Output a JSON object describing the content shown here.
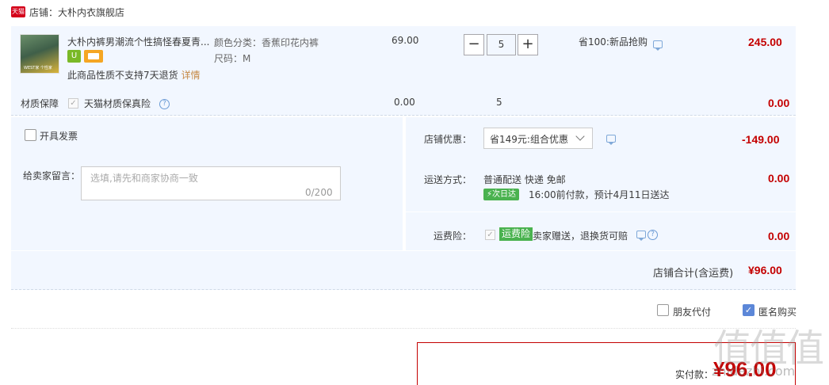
{
  "shop": {
    "logo_text": "天猫",
    "name": "店铺：大朴内衣旗舰店"
  },
  "item": {
    "thumb_caption": "WEST家 个性家",
    "title": "大朴内裤男潮流个性搞怪春夏青...",
    "badge_icon": "U",
    "notice": "此商品性质不支持7天退货",
    "notice_link": "详情",
    "sku_color": "颜色分类：香蕉印花内裤",
    "sku_size": "尺码：M",
    "unit_price": "69.00",
    "qty_minus": "−",
    "qty_value": "5",
    "qty_plus": "+",
    "promo": "省100:新品抢购",
    "subtotal": "245.00"
  },
  "insurance": {
    "label": "材质保障",
    "check_mark": "✓",
    "name": "天猫材质保真险",
    "help": "?",
    "price": "0.00",
    "qty": "5",
    "total": "0.00"
  },
  "invoice": {
    "label": "开具发票"
  },
  "message": {
    "label": "给卖家留言：",
    "placeholder": "选填,请先和商家协商一致",
    "count": "0/200"
  },
  "coupon": {
    "label": "店铺优惠：",
    "selected": "省149元:组合优惠",
    "amount": "-149.00"
  },
  "shipping": {
    "label": "运送方式：",
    "method": "普通配送 快递 免邮",
    "nextday_badge": "⚡次日达",
    "eta": "16:00前付款，预计4月11日送达",
    "amount": "0.00"
  },
  "freight_ins": {
    "label": "运费险：",
    "check_mark": "✓",
    "badge": "运费险",
    "text": "卖家赠送，退换货可赔",
    "help": "?",
    "amount": "0.00"
  },
  "shop_total": {
    "label": "店铺合计(含运费)",
    "amount": "¥96.00"
  },
  "options": {
    "friend_pay": "朋友代付",
    "anonymous": "匿名购买",
    "anonymous_mark": "✓"
  },
  "pay": {
    "label": "实付款：",
    "amount": "¥96.00"
  },
  "watermark": {
    "logo": "值值值",
    "site": "zhidezhi.com"
  }
}
